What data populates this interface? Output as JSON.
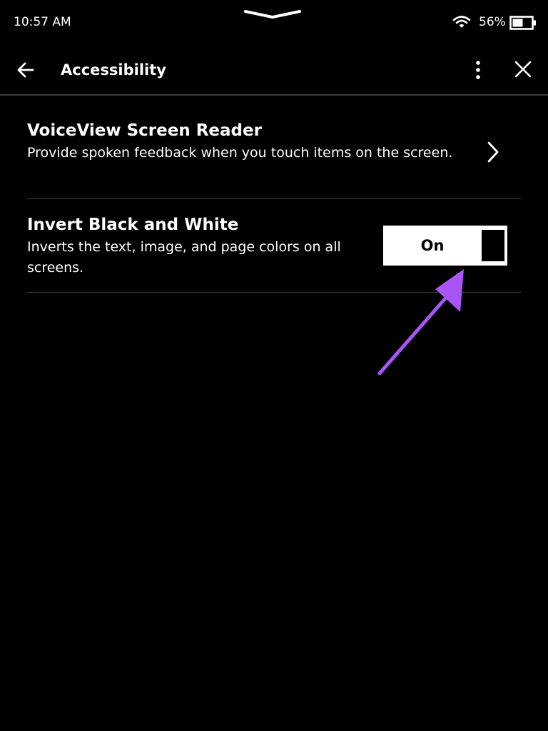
{
  "status_bar": {
    "time": "10:57 AM",
    "battery_percent": "56%",
    "wifi_icon": "wifi-icon",
    "battery_icon": "battery-icon",
    "battery_level": 0.56
  },
  "header": {
    "title": "Accessibility",
    "back_icon": "arrow-left-icon",
    "more_icon": "more-vertical-icon",
    "close_icon": "close-icon"
  },
  "settings": [
    {
      "title": "VoiceView Screen Reader",
      "description": "Provide spoken feedback when you touch items on the screen.",
      "control": "chevron-right-icon"
    },
    {
      "title": "Invert Black and White",
      "description": "Inverts the text, image, and page colors on all screens.",
      "control": "toggle",
      "toggle_label": "On",
      "toggle_state": true
    }
  ],
  "annotation": {
    "type": "arrow",
    "color": "#a855f7"
  },
  "colors": {
    "background": "#000000",
    "text": "#ffffff",
    "divider": "#3a3a3a",
    "toggle_fill": "#ffffff",
    "annotation": "#a855f7"
  }
}
